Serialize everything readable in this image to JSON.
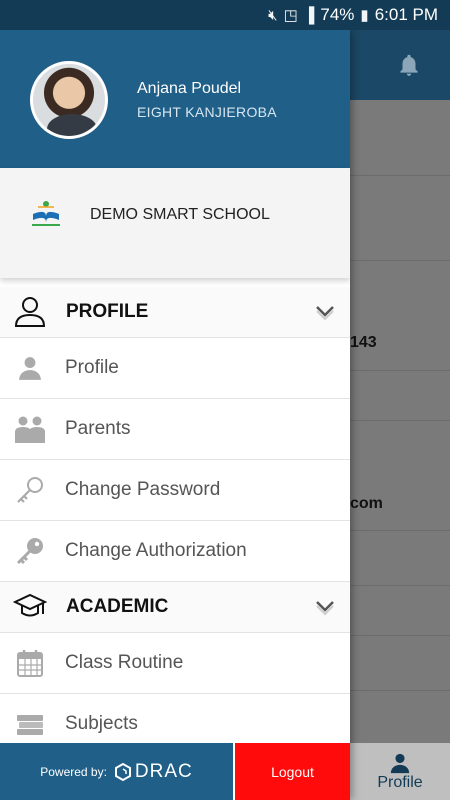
{
  "status_bar": {
    "battery": "74%",
    "time": "6:01 PM"
  },
  "background": {
    "visible_texts": [
      "143",
      "com"
    ],
    "bottom_nav_label": "Profile"
  },
  "drawer": {
    "user": {
      "name": "Anjana Poudel",
      "class": "EIGHT KANJIEROBA"
    },
    "school": {
      "name": "DEMO SMART SCHOOL"
    },
    "sections": [
      {
        "label": "PROFILE",
        "icon": "user-outline-icon",
        "items": [
          {
            "label": "Profile",
            "icon": "person-icon"
          },
          {
            "label": "Parents",
            "icon": "parents-icon"
          },
          {
            "label": "Change Password",
            "icon": "key-outline-icon"
          },
          {
            "label": "Change Authorization",
            "icon": "key-icon"
          }
        ]
      },
      {
        "label": "ACADEMIC",
        "icon": "graduation-cap-icon",
        "items": [
          {
            "label": "Class Routine",
            "icon": "calendar-icon"
          },
          {
            "label": "Subjects",
            "icon": "books-icon"
          }
        ]
      }
    ],
    "footer": {
      "powered_by": "Powered by:",
      "brand": "DRAC",
      "logout": "Logout"
    }
  },
  "colors": {
    "primary": "#1f5f88",
    "status_bar": "#133b55",
    "logout": "#ff0b0b"
  }
}
